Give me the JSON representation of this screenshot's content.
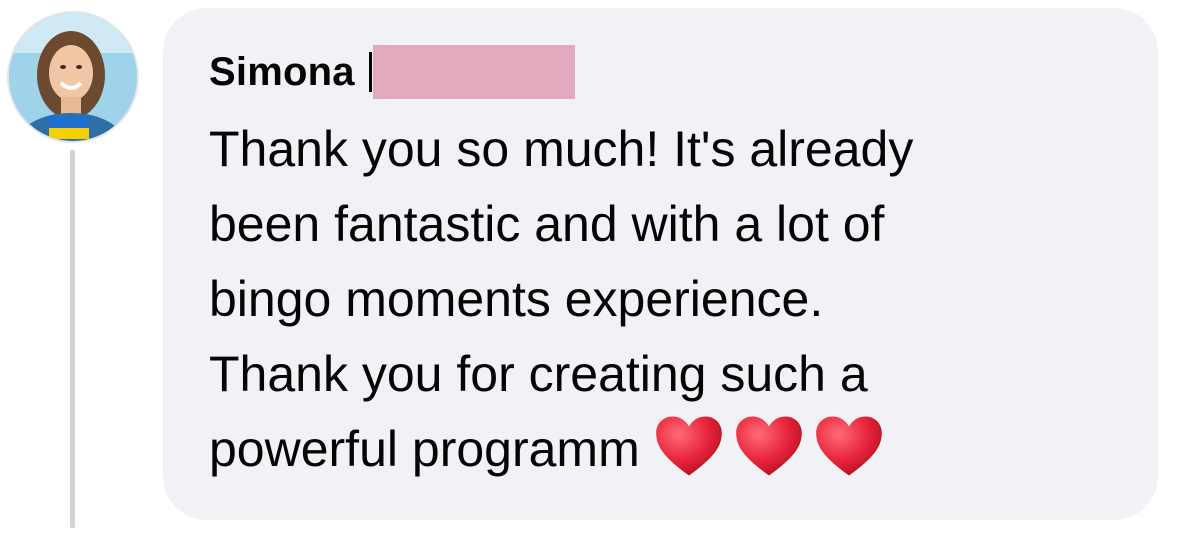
{
  "comment": {
    "author": "Simona",
    "text": "Thank you so much! It's already\nbeen fantastic and with a lot of\nbingo moments experience.\nThank you for creating such a\npowerful programm",
    "emoji": [
      "red-heart",
      "red-heart",
      "red-heart"
    ]
  },
  "colors": {
    "bubble": "#f0f2f5",
    "text": "#050505",
    "redaction": "#e2a9bf",
    "heart": "#e8233a"
  }
}
